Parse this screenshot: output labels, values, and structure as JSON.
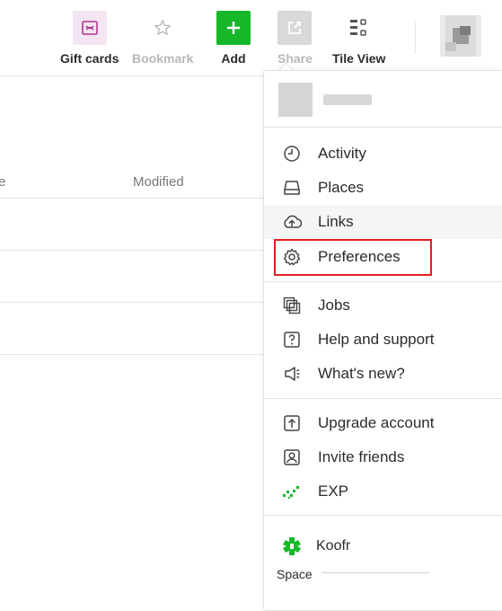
{
  "toolbar": {
    "gift_cards": "Gift cards",
    "bookmark": "Bookmark",
    "add": "Add",
    "share": "Share",
    "tile_view": "Tile View",
    "icons": {
      "gift_cards": "gift-icon",
      "bookmark": "star-icon",
      "add": "plus-icon",
      "share": "share-icon",
      "tile_view": "tile-view-icon"
    }
  },
  "list": {
    "column_partial": "e",
    "column_modified": "Modified"
  },
  "menu": {
    "items": [
      {
        "label": "Activity",
        "icon": "clock-icon"
      },
      {
        "label": "Places",
        "icon": "drive-icon"
      },
      {
        "label": "Links",
        "icon": "cloud-upload-icon"
      },
      {
        "label": "Preferences",
        "icon": "gear-icon"
      },
      {
        "label": "Jobs",
        "icon": "stack-icon"
      },
      {
        "label": "Help and support",
        "icon": "question-icon"
      },
      {
        "label": "What's new?",
        "icon": "megaphone-icon"
      },
      {
        "label": "Upgrade account",
        "icon": "upgrade-icon"
      },
      {
        "label": "Invite friends",
        "icon": "invite-user-icon"
      },
      {
        "label": "EXP",
        "icon": "exp-icon"
      }
    ],
    "brand": "Koofr",
    "space_label": "Space"
  },
  "colors": {
    "accent_green": "#16b82a",
    "gift_bg": "#f3e5f1",
    "gift_icon": "#b0358f",
    "highlight_red": "#e02020"
  }
}
